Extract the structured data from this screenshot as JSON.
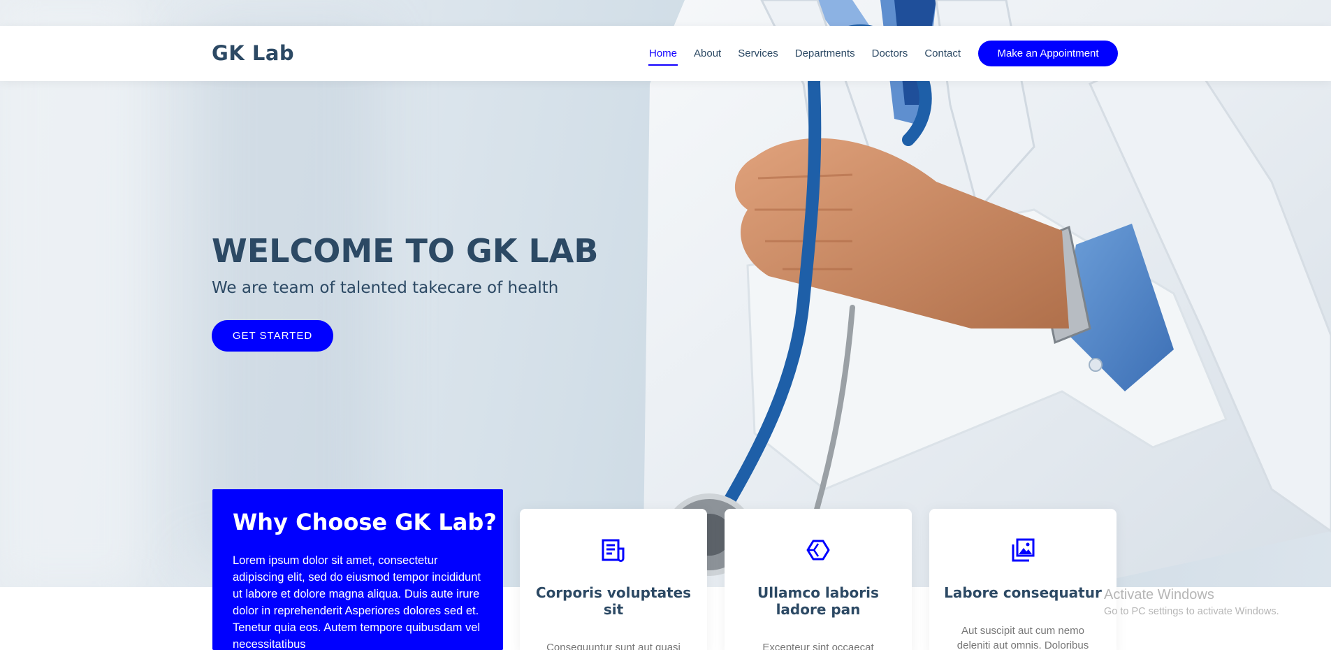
{
  "brand": {
    "name": "GK Lab"
  },
  "nav": {
    "items": [
      {
        "label": "Home",
        "active": true
      },
      {
        "label": "About",
        "active": false
      },
      {
        "label": "Services",
        "active": false
      },
      {
        "label": "Departments",
        "active": false
      },
      {
        "label": "Doctors",
        "active": false
      },
      {
        "label": "Contact",
        "active": false
      }
    ],
    "appointment_label": "Make an Appointment"
  },
  "hero": {
    "title": "WELCOME TO GK LAB",
    "subtitle": "We are team of talented takecare of health",
    "cta_label": "GET STARTED"
  },
  "why": {
    "title": "Why Choose GK Lab?",
    "text": "Lorem ipsum dolor sit amet, consectetur adipiscing elit, sed do eiusmod tempor incididunt ut labore et dolore magna aliqua. Duis aute irure dolor in reprehenderit Asperiores dolores sed et. Tenetur quia eos. Autem tempore quibusdam vel necessitatibus"
  },
  "features": [
    {
      "icon": "receipt-icon",
      "title": "Corporis voluptates sit",
      "text": "Consequuntur sunt aut quasi"
    },
    {
      "icon": "cube-icon",
      "title": "Ullamco laboris ladore pan",
      "text": "Excepteur sint occaecat"
    },
    {
      "icon": "images-icon",
      "title": "Labore consequatur",
      "text": "Aut suscipit aut cum nemo deleniti aut omnis. Doloribus"
    }
  ],
  "watermark": {
    "line1": "Activate Windows",
    "line2": "Go to PC settings to activate Windows."
  },
  "colors": {
    "accent": "#0000ff",
    "heading": "#2c4964",
    "muted": "#777777"
  }
}
